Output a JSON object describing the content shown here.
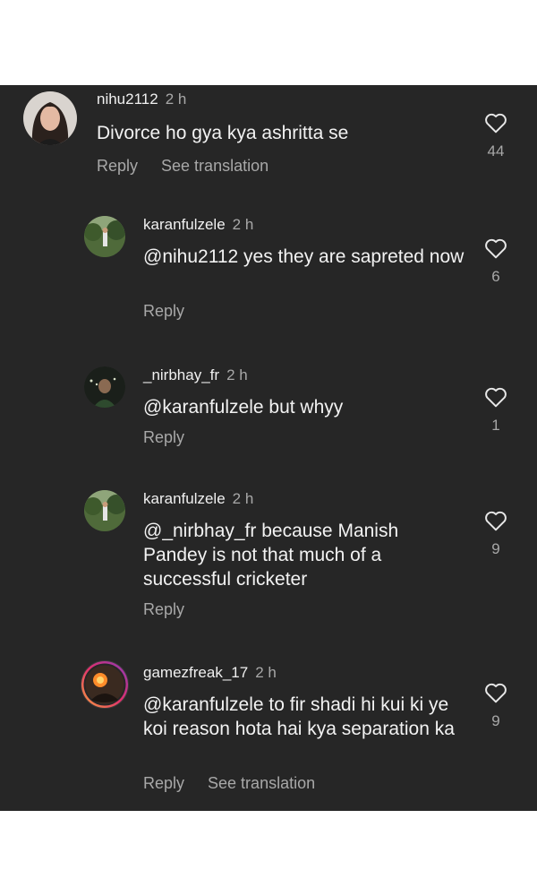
{
  "comments": [
    {
      "username": "nihu2112",
      "time": "2 h",
      "text": "Divorce ho gya kya ashritta se",
      "reply_label": "Reply",
      "translate_label": "See translation",
      "likes": "44",
      "avatar_icon": "profile-photo-woman"
    },
    {
      "username": "karanfulzele",
      "time": "2 h",
      "text": "@nihu2112 yes they are sapreted now",
      "reply_label": "Reply",
      "likes": "6",
      "avatar_icon": "profile-photo-outdoor"
    },
    {
      "username": "_nirbhay_fr",
      "time": "2 h",
      "text": "@karanfulzele but whyy",
      "reply_label": "Reply",
      "likes": "1",
      "avatar_icon": "profile-photo-man"
    },
    {
      "username": "karanfulzele",
      "time": "2 h",
      "text": "@_nirbhay_fr because Manish Pandey is not that much of a successful cricketer",
      "reply_label": "Reply",
      "likes": "9",
      "avatar_icon": "profile-photo-outdoor"
    },
    {
      "username": "gamezfreak_17",
      "time": "2 h",
      "text": "@karanfulzele to fir shadi hi kui ki ye koi reason hota hai kya separation ka",
      "reply_label": "Reply",
      "translate_label": "See translation",
      "likes": "9",
      "avatar_icon": "profile-photo-story-ring"
    }
  ],
  "colors": {
    "panel_bg": "#262626",
    "text": "#f2f2f2",
    "muted": "#a8a8a8",
    "story_ring": "#c13584"
  }
}
